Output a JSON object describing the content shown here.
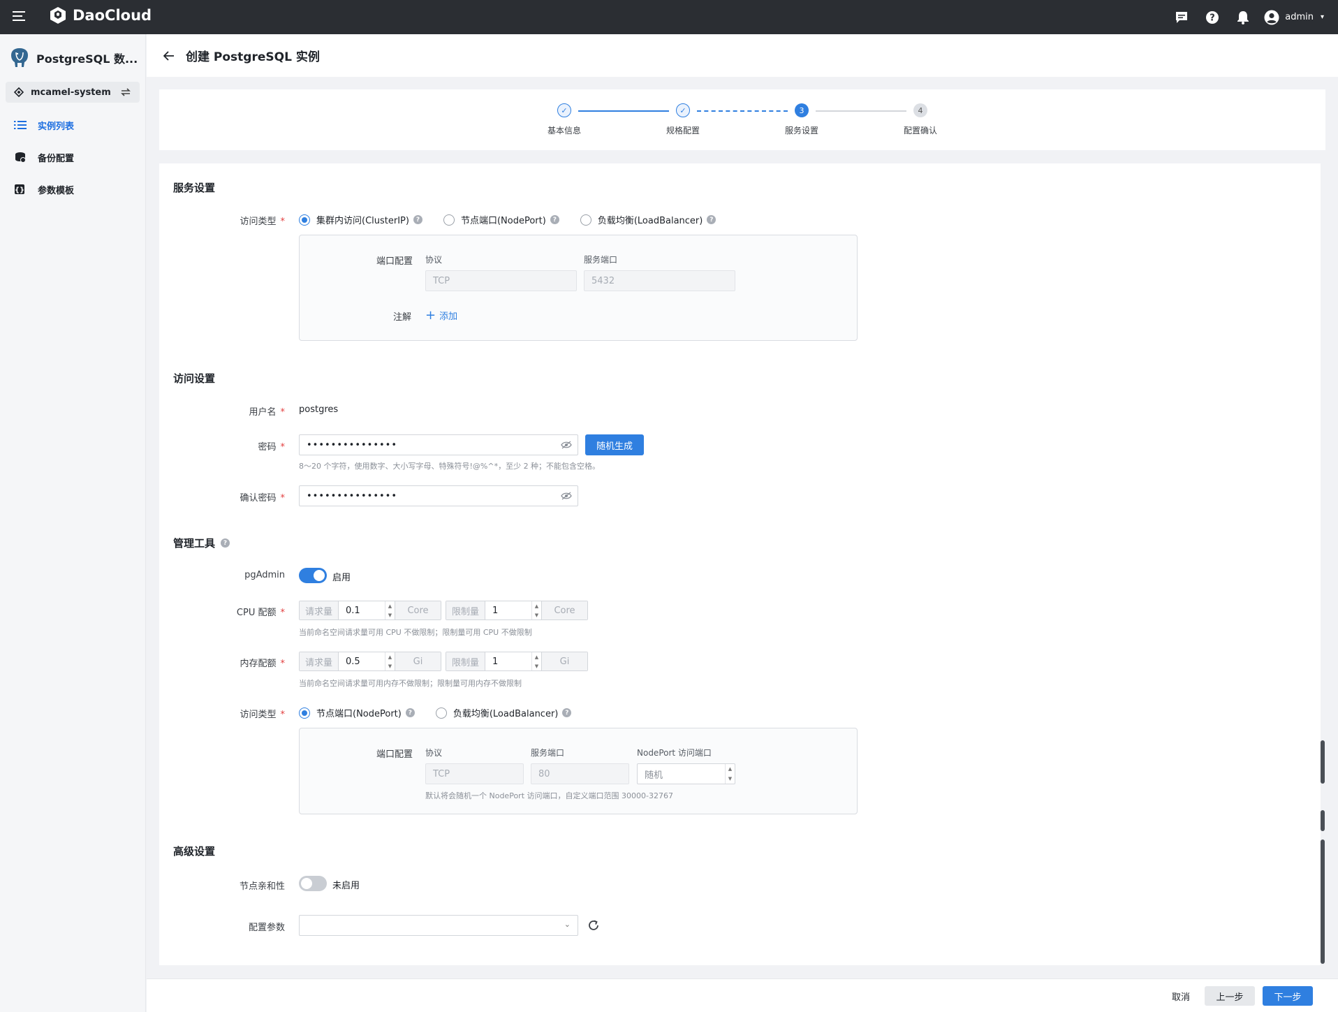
{
  "topbar": {
    "brand": "DaoCloud",
    "user": "admin"
  },
  "sidebar": {
    "title": "PostgreSQL 数...",
    "namespace": "mcamel-system",
    "items": [
      {
        "label": "实例列表",
        "active": true
      },
      {
        "label": "备份配置",
        "active": false
      },
      {
        "label": "参数模板",
        "active": false
      }
    ]
  },
  "page": {
    "title": "创建 PostgreSQL 实例"
  },
  "steps": [
    {
      "num": "1",
      "label": "基本信息",
      "state": "done"
    },
    {
      "num": "2",
      "label": "规格配置",
      "state": "done"
    },
    {
      "num": "3",
      "label": "服务设置",
      "state": "current"
    },
    {
      "num": "4",
      "label": "配置确认",
      "state": "todo"
    }
  ],
  "service": {
    "section_title": "服务设置",
    "access_type_label": "访问类型",
    "options": [
      "集群内访问(ClusterIP)",
      "节点端口(NodePort)",
      "负载均衡(LoadBalancer)"
    ],
    "port_config_label": "端口配置",
    "protocol_label": "协议",
    "service_port_label": "服务端口",
    "protocol_value": "TCP",
    "port_value": "5432",
    "annotation_label": "注解",
    "add_label": "添加"
  },
  "access": {
    "section_title": "访问设置",
    "username_label": "用户名",
    "username_value": "postgres",
    "password_label": "密码",
    "password_value": "•••••••••••••••",
    "random_button": "随机生成",
    "password_hint": "8～20 个字符，使用数字、大小写字母、特殊符号!@%^*，至少 2 种；不能包含空格。",
    "confirm_label": "确认密码",
    "confirm_value": "•••••••••••••••"
  },
  "tools": {
    "section_title": "管理工具",
    "pgadmin_label": "pgAdmin",
    "pgadmin_status": "启用",
    "cpu_label": "CPU 配额",
    "mem_label": "内存配额",
    "request_label": "请求量",
    "limit_label": "限制量",
    "cpu_request": "0.1",
    "cpu_limit": "1",
    "cpu_unit": "Core",
    "mem_request": "0.5",
    "mem_limit": "1",
    "mem_unit": "Gi",
    "cpu_hint": "当前命名空间请求量可用 CPU 不做限制；限制量可用 CPU 不做限制",
    "mem_hint": "当前命名空间请求量可用内存不做限制；限制量可用内存不做限制",
    "access_type_label": "访问类型",
    "options": [
      "节点端口(NodePort)",
      "负载均衡(LoadBalancer)"
    ],
    "port_config_label": "端口配置",
    "protocol_label": "协议",
    "service_port_label": "服务端口",
    "nodeport_label": "NodePort 访问端口",
    "protocol_value": "TCP",
    "port_value": "80",
    "nodeport_value": "随机",
    "nodeport_hint": "默认将会随机一个 NodePort 访问端口，自定义端口范围 30000-32767"
  },
  "advanced": {
    "section_title": "高级设置",
    "affinity_label": "节点亲和性",
    "affinity_status": "未启用",
    "config_label": "配置参数",
    "config_value": ""
  },
  "footer": {
    "cancel": "取消",
    "prev": "上一步",
    "next": "下一步"
  },
  "colors": {
    "accent": "#2f7fe0",
    "topbar": "#2b2e33",
    "required": "#e23e3e"
  }
}
